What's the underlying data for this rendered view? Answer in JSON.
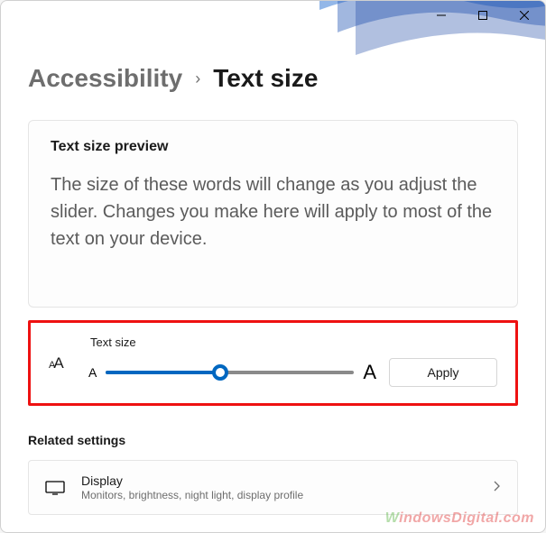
{
  "titlebar": {
    "minimize": "minimize",
    "maximize": "maximize",
    "close": "close"
  },
  "breadcrumb": {
    "parent": "Accessibility",
    "separator": "›",
    "current": "Text size"
  },
  "preview": {
    "title": "Text size preview",
    "body": "The size of these words will change as you adjust the slider. Changes you make here will apply to most of the text on your device."
  },
  "slider": {
    "label": "Text size",
    "min_glyph": "A",
    "max_glyph": "A",
    "apply_label": "Apply",
    "value_percent": 46
  },
  "related": {
    "heading": "Related settings",
    "display": {
      "title": "Display",
      "subtitle": "Monitors, brightness, night light, display profile"
    }
  },
  "watermark": "WindowsDigital.com"
}
